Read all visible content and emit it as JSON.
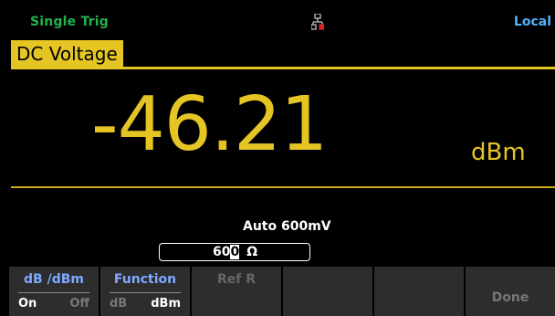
{
  "status": {
    "trigger_mode": "Single Trig",
    "remote_state": "Local",
    "network_icon": "lan-icon"
  },
  "measurement": {
    "function": "DC Voltage",
    "reading": "-46.21",
    "unit": "dBm",
    "range": "Auto 600mV"
  },
  "ref_input": {
    "value_before_cursor": "60",
    "cursor_char": "0",
    "unit": "Ω"
  },
  "softkeys": [
    {
      "title": "dB /dBm",
      "options": [
        "On",
        "Off"
      ],
      "selected": "On"
    },
    {
      "title": "Function",
      "options": [
        "dB",
        "dBm"
      ],
      "selected": "dBm"
    },
    {
      "title": "Ref R"
    },
    {
      "title": ""
    },
    {
      "title": ""
    },
    {
      "title": "Done"
    }
  ],
  "colors": {
    "accent": "#e5c524",
    "trigger": "#22b24c",
    "local": "#4fb4ff",
    "softkey_title": "#7fa8ff",
    "softkey_bg": "#2d2d2d"
  }
}
